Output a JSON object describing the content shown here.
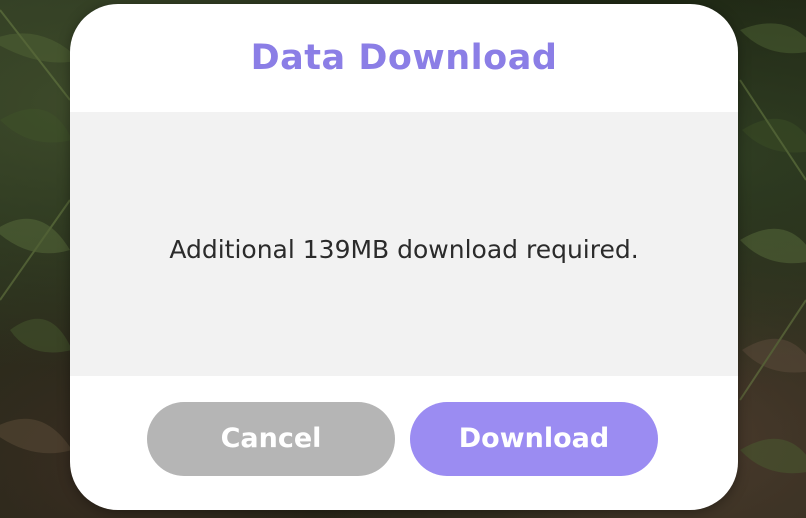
{
  "dialog": {
    "title": "Data Download",
    "message": "Additional 139MB download required.",
    "cancel_label": "Cancel",
    "download_label": "Download"
  },
  "colors": {
    "title": "#8b7ee6",
    "body_background": "#f2f2f2",
    "cancel_button": "#b5b5b5",
    "download_button": "#9b8cf2"
  }
}
